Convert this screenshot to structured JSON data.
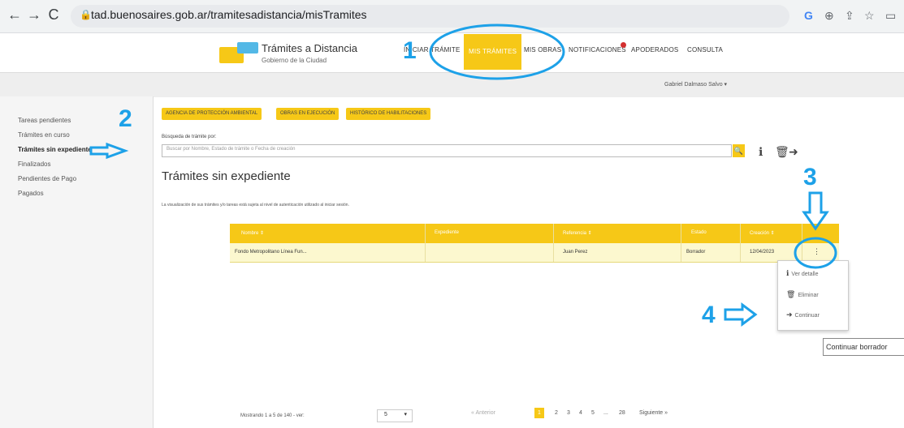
{
  "browser": {
    "url": "tad.buenosaires.gob.ar/tramitesadistancia/misTramites"
  },
  "header": {
    "brand_title": "Trámites a Distancia",
    "brand_subtitle": "Gobierno de la Ciudad",
    "nav": [
      "INICIAR TRÁMITE",
      "MIS TRÁMITES",
      "MIS OBRAS",
      "NOTIFICACIONES",
      "APODERADOS",
      "CONSULTA"
    ],
    "active_nav": "MIS TRÁMITES",
    "user": "Gabriel Dalmaso Salvo ▾"
  },
  "sidebar": {
    "items": [
      "Tareas pendientes",
      "Trámites en curso",
      "Trámites sin expediente",
      "Finalizados",
      "Pendientes de Pago",
      "Pagados"
    ],
    "active": "Trámites sin expediente"
  },
  "main": {
    "tags": [
      "AGENCIA DE PROTECCIÓN AMBIENTAL",
      "OBRAS EN EJECUCIÓN",
      "HISTÓRICO DE HABILITACIONES"
    ],
    "search_label": "Búsqueda de trámite por:",
    "search_placeholder": "Buscar por Nombre, Estado de trámite o Fecha de creación",
    "title": "Trámites sin expediente",
    "visual_note": "La visualización de sus trámites y/o tareas está sujeta al nivel de autenticación utilizado al iniciar sesión."
  },
  "table": {
    "headers": [
      "Nombre ⇕",
      "Expediente",
      "Referencia ⇕",
      "Estado",
      "Creación ⇕"
    ],
    "rows": [
      {
        "nombre": "Fondo Metropolitano Línea Fun...",
        "expediente": "",
        "referencia": "Juan Perez",
        "estado": "Borrador",
        "creacion": "12/04/2023",
        "menu": "⋮"
      }
    ]
  },
  "menu": {
    "items": [
      {
        "icon": "info-icon",
        "label": "Ver detalle"
      },
      {
        "icon": "trash-icon",
        "label": "Eliminar"
      },
      {
        "icon": "arrow-right-icon",
        "label": "Continuar"
      }
    ],
    "tooltip": "Continuar borrador"
  },
  "pagination": {
    "showing": "Mostrando 1 a 5 de 140 - ver:",
    "page_size": "5",
    "prev": "« Anterior",
    "pages": [
      "1",
      "2",
      "3",
      "4",
      "5",
      "...",
      "28"
    ],
    "next": "Siguiente »"
  },
  "annotations": [
    "1",
    "2",
    "3",
    "4"
  ],
  "colors": {
    "accent": "#f6c817",
    "annotation": "#1da1e8"
  }
}
